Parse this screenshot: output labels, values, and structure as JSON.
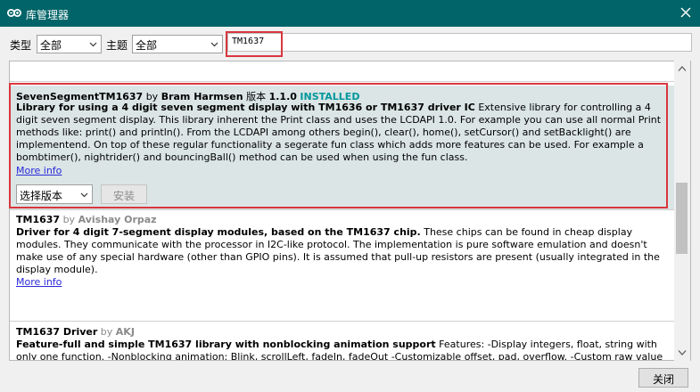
{
  "window": {
    "title": "库管理器",
    "icon": "arduino-infinity-icon",
    "close_icon": "close-icon",
    "titlebar_color": "#006468"
  },
  "filters": {
    "type_label": "类型",
    "type_value": "全部",
    "topic_label": "主题",
    "topic_value": "全部",
    "search_value": "TM1637"
  },
  "libraries": [
    {
      "name": "SevenSegmentTM1637",
      "by": "by",
      "author": "Bram Harmsen",
      "version_label": "版本",
      "version": "1.1.0",
      "status": "INSTALLED",
      "summary": "Library for using a 4 digit seven segment display with TM1636 or TM1637 driver IC",
      "description": "Extensive library for controlling a 4 digit seven segment display. This library inherent the Print class and uses the LCDAPI 1.0. For example you can use all normal Print methods like: print() and println(). From the LCDAPI among others begin(), clear(), home(), setCursor() and setBacklight() are implementend. On top of these regular functionality a segerate fun class which adds more features can be used. For example a bombtimer(), nightrider() and bouncingBall() method can be used when using the fun class.",
      "more_info": "More info",
      "version_select": "选择版本",
      "install_button": "安装"
    },
    {
      "name": "TM1637",
      "by": "by",
      "author": "Avishay Orpaz",
      "summary": "Driver for 4 digit 7-segment display modules, based on the TM1637 chip.",
      "description": "These chips can be found in cheap display modules. They communicate with the processor in I2C-like protocol. The implementation is pure software emulation and doesn't make use of any special hardware (other than GPIO pins). It is assumed that pull-up resistors are present (usually integrated in the display module).",
      "more_info": "More info"
    },
    {
      "name": "TM1637 Driver",
      "by": "by",
      "author": "AKJ",
      "summary": "Feature-full and simple TM1637 library with nonblocking animation support",
      "description": "Features: -Display integers, float, string with only one function. -Nonblocking animation: Blink, scrollLeft, fadeIn, fadeOut -Customizable offset, pad, overflow. -Custom raw value"
    }
  ],
  "footer": {
    "close_button": "关闭"
  },
  "colors": {
    "installed": "#00979c",
    "link": "#2929d9",
    "highlight": "#d9363e",
    "selected_row": "#dbe5e5"
  }
}
